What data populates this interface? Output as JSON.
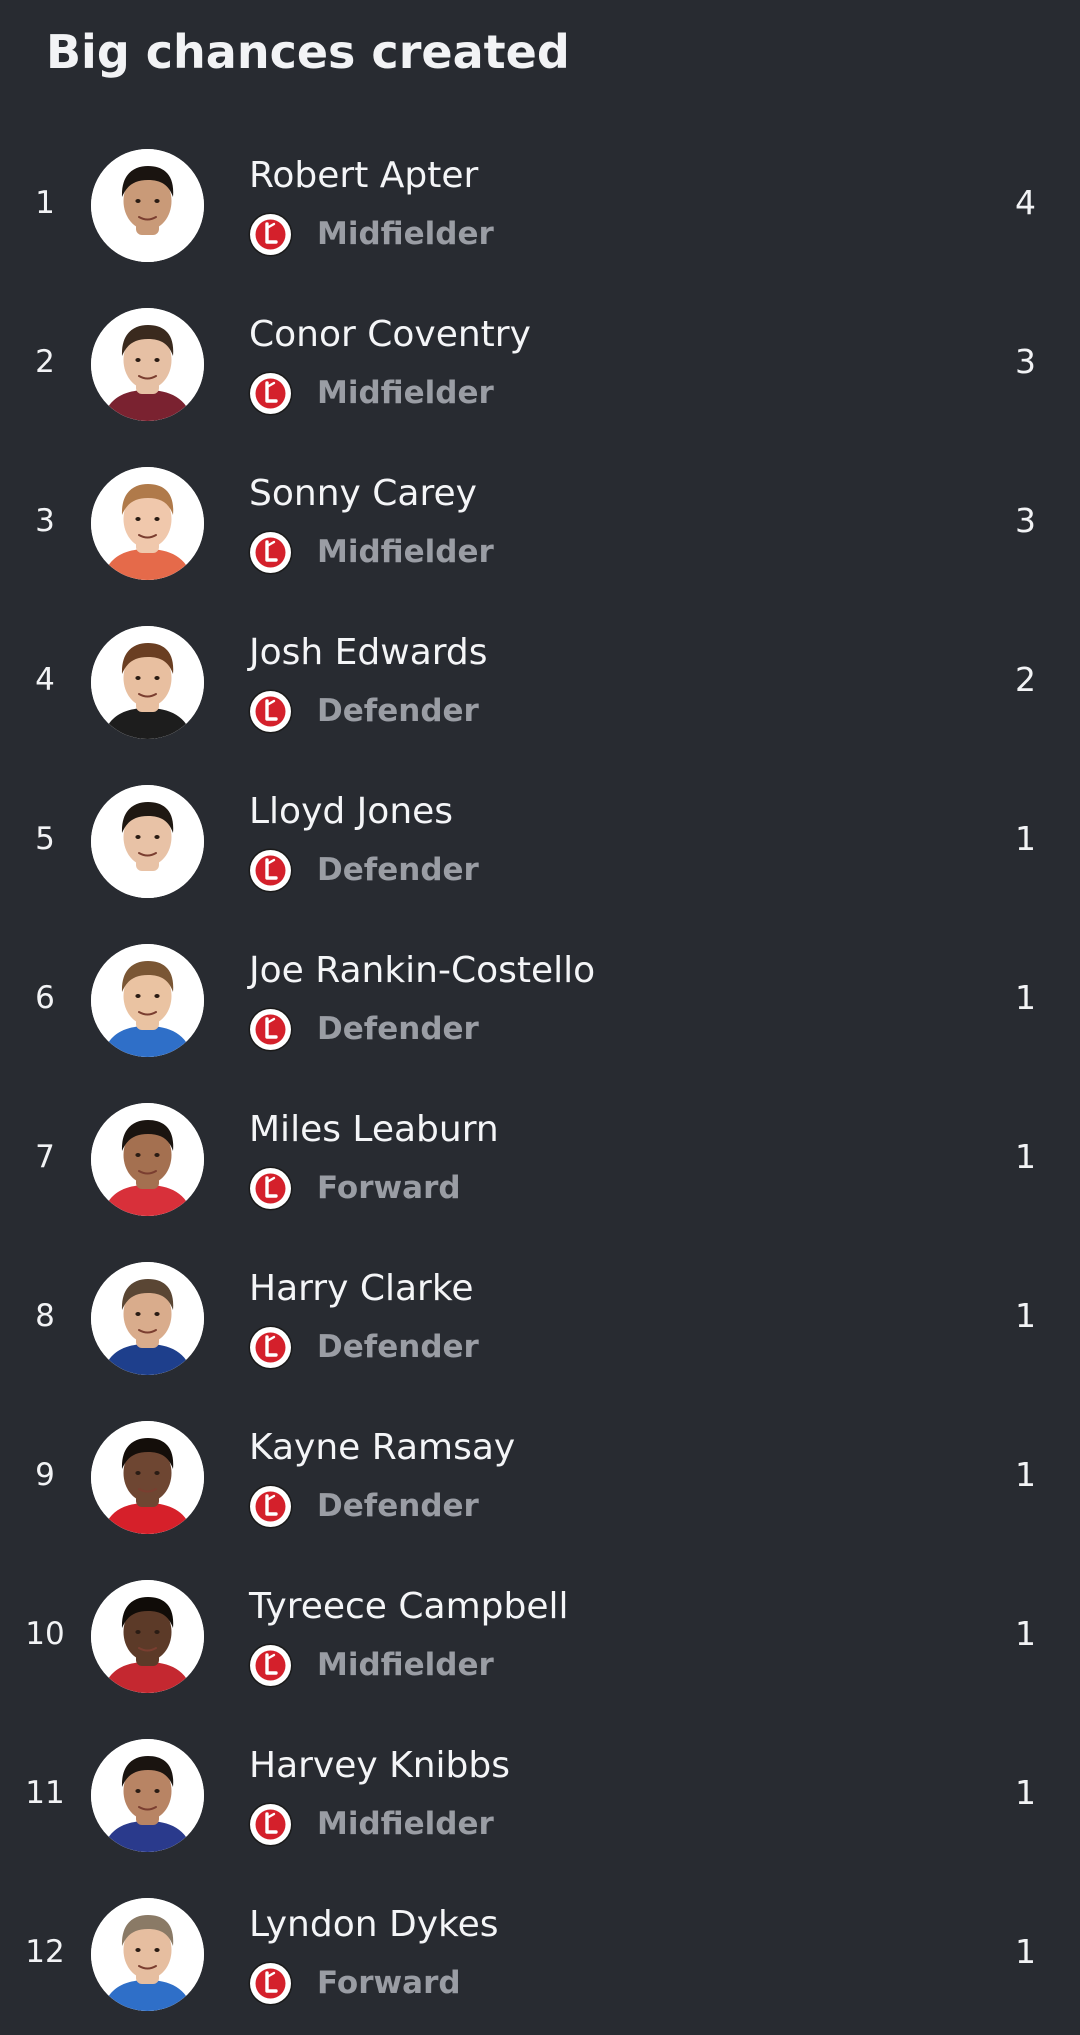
{
  "header": {
    "title": "Big chances created"
  },
  "club_badge": {
    "icon": "club-crest-icon",
    "colors": {
      "ring": "#ffffff",
      "fill": "#d4202b",
      "text": "#1a1a1a"
    }
  },
  "players": [
    {
      "rank": "1",
      "name": "Robert Apter",
      "position": "Midfielder",
      "value": "4",
      "skin": "#c99a78",
      "hair": "#1a1410",
      "shirt": "#ffffff"
    },
    {
      "rank": "2",
      "name": "Conor Coventry",
      "position": "Midfielder",
      "value": "3",
      "skin": "#e6c0a4",
      "hair": "#3a2a1e",
      "shirt": "#7a2230"
    },
    {
      "rank": "3",
      "name": "Sonny Carey",
      "position": "Midfielder",
      "value": "3",
      "skin": "#f0c8ac",
      "hair": "#b07a4a",
      "shirt": "#e56a4a"
    },
    {
      "rank": "4",
      "name": "Josh Edwards",
      "position": "Defender",
      "value": "2",
      "skin": "#e8bfa0",
      "hair": "#6a3e22",
      "shirt": "#1d1d1d"
    },
    {
      "rank": "5",
      "name": "Lloyd Jones",
      "position": "Defender",
      "value": "1",
      "skin": "#e8c2a6",
      "hair": "#1f1812",
      "shirt": "#ffffff"
    },
    {
      "rank": "6",
      "name": "Joe Rankin-Costello",
      "position": "Defender",
      "value": "1",
      "skin": "#eac3a2",
      "hair": "#7a5634",
      "shirt": "#2f6fc8"
    },
    {
      "rank": "7",
      "name": "Miles Leaburn",
      "position": "Forward",
      "value": "1",
      "skin": "#a47050",
      "hair": "#1a1410",
      "shirt": "#d8303a"
    },
    {
      "rank": "8",
      "name": "Harry Clarke",
      "position": "Defender",
      "value": "1",
      "skin": "#d9ac8c",
      "hair": "#5a4634",
      "shirt": "#1e3f8c"
    },
    {
      "rank": "9",
      "name": "Kayne Ramsay",
      "position": "Defender",
      "value": "1",
      "skin": "#6e4632",
      "hair": "#140e0a",
      "shirt": "#d6202a"
    },
    {
      "rank": "10",
      "name": "Tyreece Campbell",
      "position": "Midfielder",
      "value": "1",
      "skin": "#5c3a28",
      "hair": "#100c08",
      "shirt": "#c42830"
    },
    {
      "rank": "11",
      "name": "Harvey Knibbs",
      "position": "Midfielder",
      "value": "1",
      "skin": "#b88464",
      "hair": "#1a1410",
      "shirt": "#2a3a8c"
    },
    {
      "rank": "12",
      "name": "Lyndon Dykes",
      "position": "Forward",
      "value": "1",
      "skin": "#e6bea0",
      "hair": "#8a7a66",
      "shirt": "#2f6fc8"
    }
  ]
}
